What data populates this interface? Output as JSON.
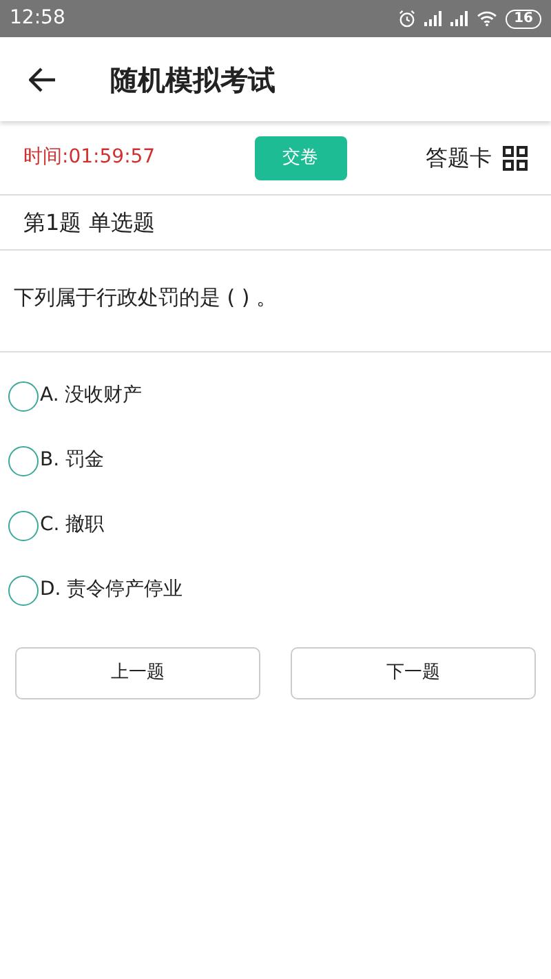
{
  "status_bar": {
    "time": "12:58",
    "battery": "16"
  },
  "app_bar": {
    "title": "随机模拟考试"
  },
  "toolbar": {
    "timer": "时间:01:59:57",
    "submit": "交卷",
    "answer_card": "答题卡"
  },
  "question": {
    "header": "第1题 单选题",
    "text": "下列属于行政处罚的是 ( ) 。",
    "options": [
      {
        "label": "A. 没收财产",
        "selected": false
      },
      {
        "label": "B. 罚金",
        "selected": false
      },
      {
        "label": "C. 撤职",
        "selected": false
      },
      {
        "label": "D. 责令停产停业",
        "selected": false
      }
    ]
  },
  "nav_buttons": [
    "上一题",
    "下一题"
  ]
}
